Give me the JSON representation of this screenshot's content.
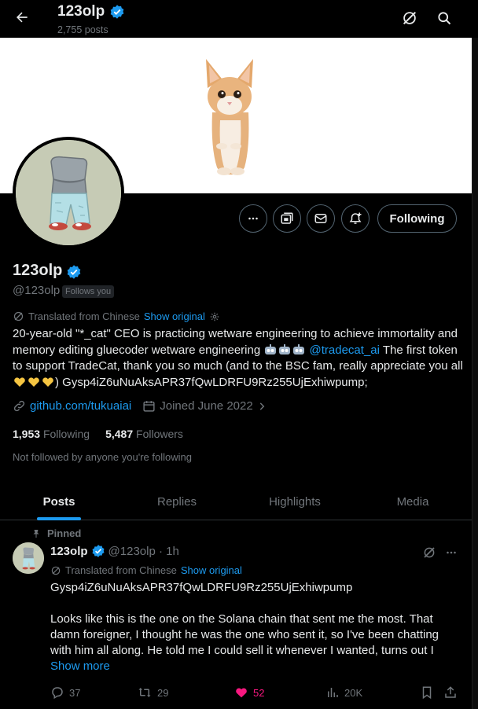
{
  "header": {
    "name": "123olp",
    "post_count": "2,755 posts"
  },
  "profile": {
    "display_name": "123olp",
    "handle": "@123olp",
    "follows_you": "Follows you",
    "translated_label": "Translated from Chinese",
    "show_original": "Show original",
    "bio": {
      "part1": "20-year-old \"*_cat\" CEO is practicing wetware engineering to achieve immortality and memory editing gluecoder wetware engineering ",
      "mention": "@tradecat_ai",
      "part2": "  The first token to support TradeCat, thank you so much (and to the BSC fam, really appreciate you all ",
      "part3": ") Gysp4iZ6uNuAksAPR37fQwLDRFU9Rz255UjExhiwpump;"
    },
    "website": "github.com/tukuaiai",
    "joined": "Joined June 2022",
    "following_count": "1,953",
    "following_label": "Following",
    "followers_count": "5,487",
    "followers_label": "Followers",
    "not_followed": "Not followed by anyone you're following"
  },
  "actions": {
    "following_button": "Following"
  },
  "tabs": [
    {
      "label": "Posts",
      "active": true
    },
    {
      "label": "Replies",
      "active": false
    },
    {
      "label": "Highlights",
      "active": false
    },
    {
      "label": "Media",
      "active": false
    }
  ],
  "post": {
    "pinned_label": "Pinned",
    "name": "123olp",
    "handle_time": "@123olp · 1h",
    "translated_label": "Translated from Chinese",
    "show_original": "Show original",
    "line1": "Gysp4iZ6uNuAksAPR37fQwLDRFU9Rz255UjExhiwpump",
    "body": "Looks like this is the one on the Solana chain that sent me the most. That damn foreigner, I thought he was the one who sent it, so I've been chatting with him all along. He told me I could sell it whenever I wanted, turns out I",
    "show_more": "Show more",
    "replies": "37",
    "reposts": "29",
    "likes": "52",
    "views": "20K"
  },
  "colors": {
    "accent": "#1d9bf0",
    "like": "#f91880",
    "muted": "#71767b",
    "verified": "#1d9bf0"
  },
  "icons": [
    "back-arrow-icon",
    "grok-icon",
    "search-icon",
    "more-icon",
    "subscribe-icon",
    "message-icon",
    "notify-icon",
    "verified-icon",
    "translate-icon",
    "gear-icon",
    "link-icon",
    "calendar-icon",
    "pin-icon",
    "reply-icon",
    "repost-icon",
    "like-icon",
    "views-icon",
    "bookmark-icon",
    "share-icon"
  ]
}
